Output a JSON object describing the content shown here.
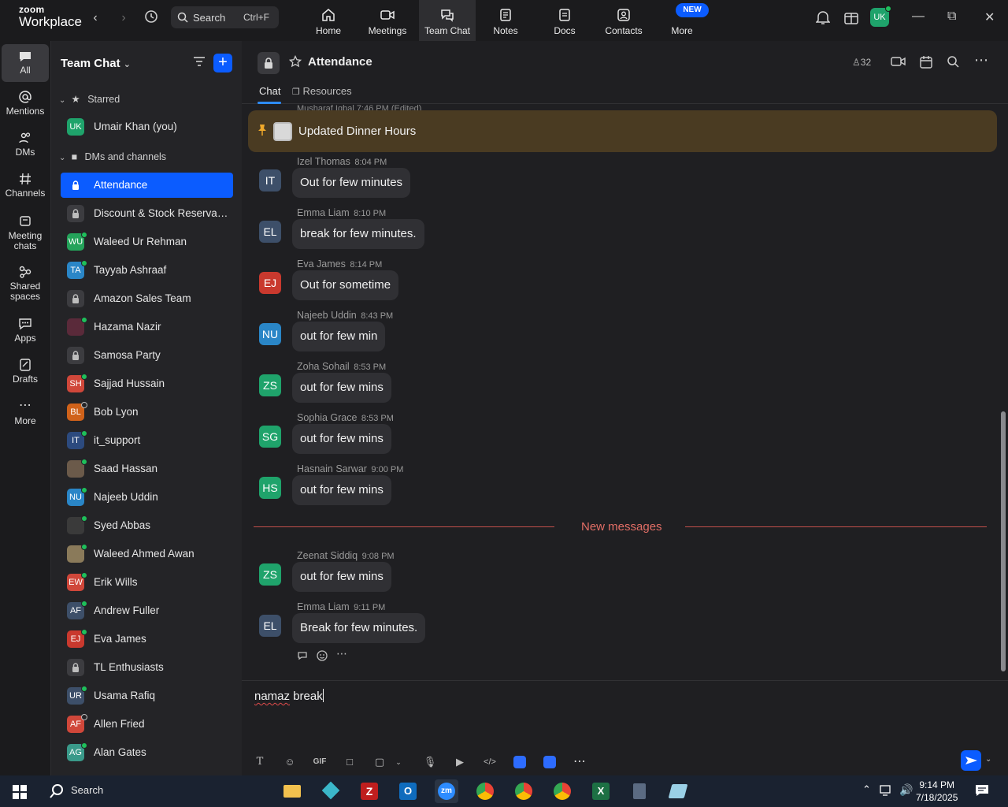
{
  "app": {
    "brand_line1": "zoom",
    "brand_line2": "Workplace"
  },
  "search": {
    "placeholder": "Search",
    "shortcut": "Ctrl+F"
  },
  "top_nav": [
    {
      "label": "Home"
    },
    {
      "label": "Meetings"
    },
    {
      "label": "Team Chat"
    },
    {
      "label": "Notes"
    },
    {
      "label": "Docs"
    },
    {
      "label": "Contacts"
    },
    {
      "label": "More",
      "badge": "NEW"
    }
  ],
  "user_avatar": "UK",
  "rail": [
    {
      "label": "All"
    },
    {
      "label": "Mentions"
    },
    {
      "label": "DMs"
    },
    {
      "label": "Channels"
    },
    {
      "label": "Meeting chats"
    },
    {
      "label": "Shared spaces"
    },
    {
      "label": "Apps"
    },
    {
      "label": "Drafts"
    },
    {
      "label": "More"
    }
  ],
  "sidebar": {
    "title": "Team Chat",
    "sections": {
      "starred": "Starred",
      "dms": "DMs and channels"
    },
    "starred_items": [
      {
        "name": "Umair Khan (you)",
        "initials": "UK",
        "color": "#1fa36b"
      }
    ],
    "items": [
      {
        "name": "Attendance",
        "type": "lock",
        "active": true
      },
      {
        "name": "Discount & Stock Reservati...",
        "type": "lock"
      },
      {
        "name": "Waleed Ur Rehman",
        "initials": "WU",
        "color": "#24a35a",
        "status": "on"
      },
      {
        "name": "Tayyab Ashraaf",
        "initials": "TA",
        "color": "#2a86c7",
        "status": "on"
      },
      {
        "name": "Amazon Sales Team",
        "type": "lock"
      },
      {
        "name": "Hazama Nazir",
        "initials": "",
        "color": "#5a2a3a",
        "status": "on"
      },
      {
        "name": "Samosa Party",
        "type": "lock"
      },
      {
        "name": "Sajjad Hussain",
        "initials": "SH",
        "color": "#d0473a",
        "status": "on"
      },
      {
        "name": "Bob Lyon",
        "initials": "BL",
        "color": "#d0621a",
        "status": "off"
      },
      {
        "name": "it_support",
        "initials": "IT",
        "color": "#2c4a7e",
        "status": "on"
      },
      {
        "name": "Saad Hassan",
        "initials": "",
        "color": "#6b5a4a",
        "status": "on"
      },
      {
        "name": "Najeeb Uddin",
        "initials": "NU",
        "color": "#2a86c7",
        "status": "on"
      },
      {
        "name": "Syed Abbas",
        "initials": "",
        "color": "#3a3a3a",
        "status": "on"
      },
      {
        "name": "Waleed Ahmed Awan",
        "initials": "",
        "color": "#8a7a5a",
        "status": "on"
      },
      {
        "name": "Erik Wills",
        "initials": "EW",
        "color": "#d0473a",
        "status": "on"
      },
      {
        "name": "Andrew Fuller",
        "initials": "AF",
        "color": "#3d4f69",
        "status": "on"
      },
      {
        "name": "Eva James",
        "initials": "EJ",
        "color": "#c9392e",
        "status": "on"
      },
      {
        "name": "TL Enthusiasts",
        "type": "lock"
      },
      {
        "name": "Usama Rafiq",
        "initials": "UR",
        "color": "#3d4f69",
        "status": "on"
      },
      {
        "name": "Allen Fried",
        "initials": "AF",
        "color": "#d0473a",
        "status": "off"
      },
      {
        "name": "Alan Gates",
        "initials": "AG",
        "color": "#3a9a8a",
        "status": "on"
      }
    ]
  },
  "channel": {
    "title": "Attendance",
    "member_count": "32",
    "tabs": [
      "Chat",
      "Resources"
    ],
    "peek_text": "Musharaf Iqbal 7:46 PM (Edited)",
    "pinned": "Updated Dinner Hours",
    "new_messages_label": "New messages"
  },
  "messages": [
    {
      "sender": "Izel Thomas",
      "time": "8:04 PM",
      "text": "Out for few minutes",
      "initials": "IT",
      "color": "#3d4f69"
    },
    {
      "sender": "Emma Liam",
      "time": "8:10 PM",
      "text": "break for few minutes.",
      "initials": "EL",
      "color": "#3d4f69"
    },
    {
      "sender": "Eva James",
      "time": "8:14 PM",
      "text": "Out for sometime",
      "initials": "EJ",
      "color": "#c9392e"
    },
    {
      "sender": "Najeeb Uddin",
      "time": "8:43 PM",
      "text": "out for few min",
      "initials": "NU",
      "color": "#2a86c7"
    },
    {
      "sender": "Zoha Sohail",
      "time": "8:53 PM",
      "text": "out for few mins",
      "initials": "ZS",
      "color": "#1fa36b"
    },
    {
      "sender": "Sophia Grace",
      "time": "8:53 PM",
      "text": "out for few mins",
      "initials": "SG",
      "color": "#1fa36b"
    },
    {
      "sender": "Hasnain Sarwar",
      "time": "9:00 PM",
      "text": "out for few mins",
      "initials": "HS",
      "color": "#1fa36b"
    }
  ],
  "new_messages": [
    {
      "sender": "Zeenat Siddiq",
      "time": "9:08 PM",
      "text": "out for few mins",
      "initials": "ZS",
      "color": "#1fa36b"
    },
    {
      "sender": "Emma Liam",
      "time": "9:11 PM",
      "text": "Break for few minutes.",
      "initials": "EL",
      "color": "#3d4f69"
    }
  ],
  "composer": {
    "text_underlined": "namaz",
    "text_rest": " break"
  },
  "taskbar": {
    "search": "Search",
    "time": "9:14 PM",
    "date": "7/18/2025"
  },
  "colors": {
    "accent": "#0b5cff",
    "online": "#1ec05b",
    "new_messages": "#e26e66",
    "pinned_bg": "#4a3b22"
  }
}
